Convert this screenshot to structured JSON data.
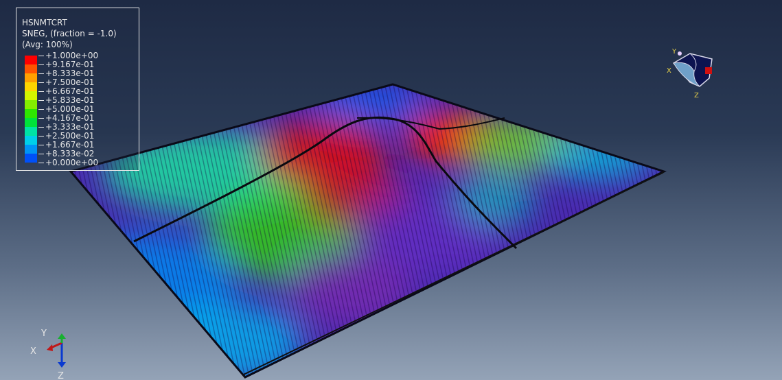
{
  "legend": {
    "variable": "HSNMTCRT",
    "section": "SNEG, (fraction = -1.0)",
    "averaging": "(Avg: 100%)",
    "levels": [
      {
        "value": "+1.000e+00",
        "color": "#ff0000"
      },
      {
        "value": "+9.167e-01",
        "color": "#ff5400"
      },
      {
        "value": "+8.333e-01",
        "color": "#ffa000"
      },
      {
        "value": "+7.500e-01",
        "color": "#ffd500"
      },
      {
        "value": "+6.667e-01",
        "color": "#d4f500"
      },
      {
        "value": "+5.833e-01",
        "color": "#84ef00"
      },
      {
        "value": "+5.000e-01",
        "color": "#2ee600"
      },
      {
        "value": "+4.167e-01",
        "color": "#00e23a"
      },
      {
        "value": "+3.333e-01",
        "color": "#00e3a4"
      },
      {
        "value": "+2.500e-01",
        "color": "#00cfe8"
      },
      {
        "value": "+1.667e-01",
        "color": "#0094f5"
      },
      {
        "value": "+8.333e-02",
        "color": "#0050f8"
      },
      {
        "value": "+0.000e+00",
        "color": "#0010ff"
      }
    ]
  },
  "triad": {
    "x": "X",
    "y": "Y",
    "z": "Z"
  },
  "view_cube": {
    "x": "X",
    "y": "Y",
    "z": "Z"
  }
}
